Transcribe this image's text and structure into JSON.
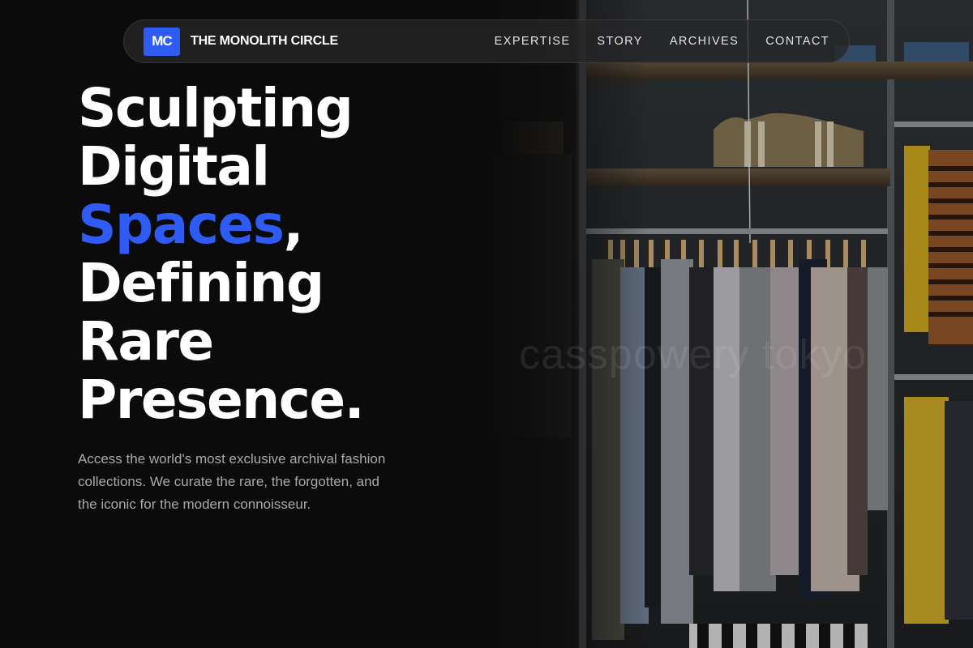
{
  "brand": {
    "logo_text": "MC",
    "name": "THE MONOLITH CIRCLE"
  },
  "nav": {
    "links": [
      "EXPERTISE",
      "STORY",
      "ARCHIVES",
      "CONTACT"
    ]
  },
  "hero": {
    "headline": {
      "line1": "Sculpting",
      "line2": "Digital",
      "line3_accent": "Spaces",
      "line3_rest": ",",
      "line4": "Defining",
      "line5": "Rare",
      "line6": "Presence."
    },
    "description": "Access the world's most exclusive archival fashion collections. We curate the rare, the forgotten, and the iconic for the modern connoisseur.",
    "image_watermark": "casspowery tokyo"
  },
  "colors": {
    "background": "#0b0b0b",
    "accent": "#2f5bf5",
    "body_text": "#a7a9ad",
    "nav_background": "#262628"
  }
}
